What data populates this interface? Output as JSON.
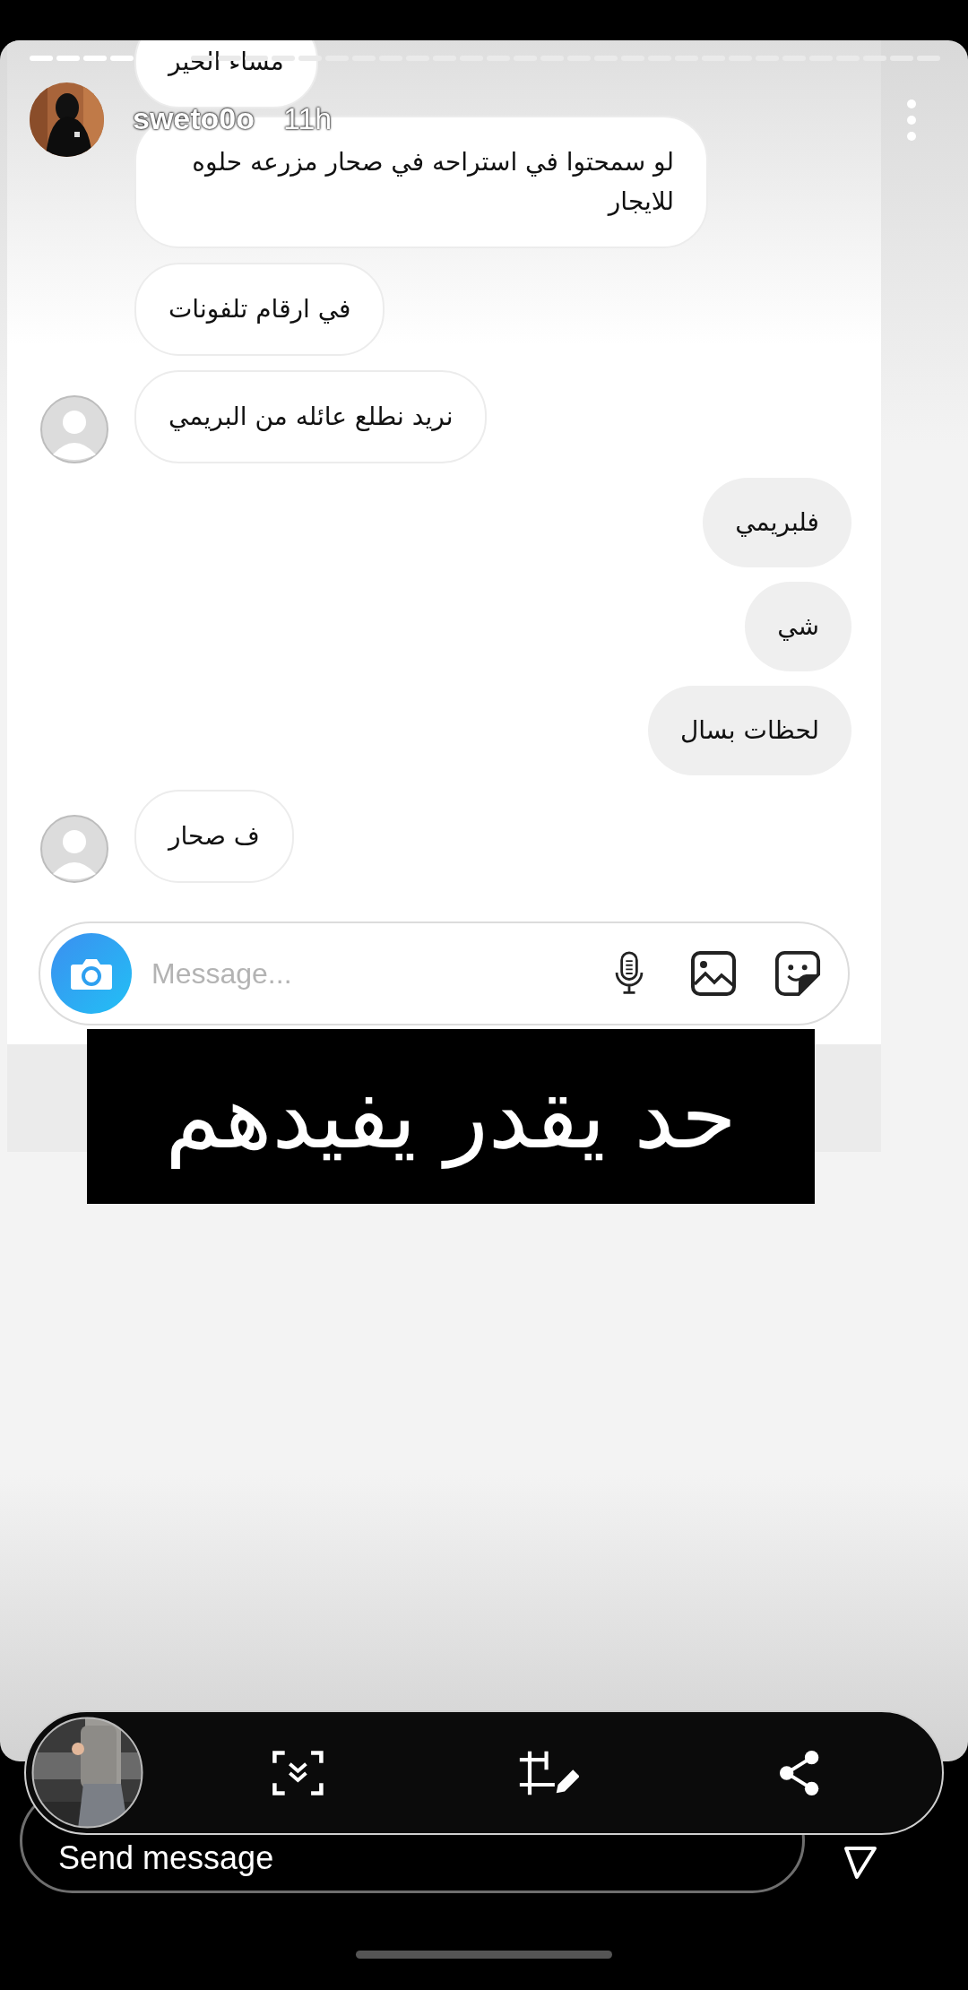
{
  "story": {
    "username": "sweto0o",
    "time": "11h"
  },
  "chat": {
    "messages": [
      {
        "kind": "received",
        "avatar": false,
        "cut_top": true,
        "text": "مساء الخير"
      },
      {
        "kind": "received",
        "avatar": false,
        "cut_top": false,
        "text": "لو سمحتوا في استراحه في صحار مزرعه حلوه للايجار"
      },
      {
        "kind": "received",
        "avatar": false,
        "cut_top": false,
        "text": "في ارقام تلفونات"
      },
      {
        "kind": "received",
        "avatar": true,
        "cut_top": false,
        "text": "نريد نطلع عائله من البريمي"
      },
      {
        "kind": "sent",
        "avatar": false,
        "cut_top": false,
        "text": "فلبريمي"
      },
      {
        "kind": "sent",
        "avatar": false,
        "cut_top": false,
        "text": "شي"
      },
      {
        "kind": "sent",
        "avatar": false,
        "cut_top": false,
        "text": "لحظات بسال"
      },
      {
        "kind": "received",
        "avatar": true,
        "cut_top": false,
        "text": "ف صحار"
      }
    ],
    "composer": {
      "placeholder": "Message..."
    }
  },
  "caption": "حد يقدر يفيدهم",
  "reply": {
    "placeholder": "Send message"
  }
}
